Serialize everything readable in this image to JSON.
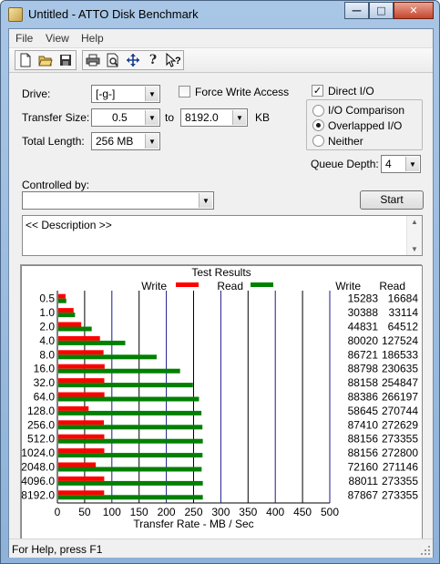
{
  "window": {
    "title": "Untitled - ATTO Disk Benchmark",
    "min": "—",
    "max": "□",
    "close": "✕"
  },
  "menu": [
    "File",
    "View",
    "Help"
  ],
  "toolbar": {
    "icons": [
      "new-icon",
      "open-icon",
      "save-icon",
      "print-icon",
      "print-preview-icon",
      "move-icon",
      "help-icon",
      "context-help-icon"
    ]
  },
  "form": {
    "drive_label": "Drive:",
    "drive_value": "[-g-]",
    "force_write_label": "Force Write Access",
    "force_write_checked": false,
    "transfer_label": "Transfer Size:",
    "transfer_from": "0.5",
    "transfer_to_word": "to",
    "transfer_to": "8192.0",
    "transfer_unit": "KB",
    "length_label": "Total Length:",
    "length_value": "256 MB",
    "direct_io_label": "Direct I/O",
    "direct_io_checked": true,
    "radio_io_comparison": "I/O Comparison",
    "radio_overlapped": "Overlapped I/O",
    "radio_neither": "Neither",
    "radio_selected": "overlapped",
    "queue_label": "Queue Depth:",
    "queue_value": "4",
    "controlled_label": "Controlled by:",
    "controlled_value": "",
    "start_label": "Start",
    "description": "<< Description >>"
  },
  "results": {
    "title": "Test Results",
    "legend_write": "Write",
    "legend_read": "Read",
    "col_write": "Write",
    "col_read": "Read",
    "xlabel": "Transfer Rate - MB / Sec",
    "write_color": "#ff0000",
    "read_color": "#008000"
  },
  "chart_data": {
    "type": "bar",
    "title": "Test Results",
    "xlabel": "Transfer Rate - MB / Sec",
    "xlim": [
      0,
      500
    ],
    "xticks": [
      0,
      50,
      100,
      150,
      200,
      250,
      300,
      350,
      400,
      450,
      500
    ],
    "categories": [
      "0.5",
      "1.0",
      "2.0",
      "4.0",
      "8.0",
      "16.0",
      "32.0",
      "64.0",
      "128.0",
      "256.0",
      "512.0",
      "1024.0",
      "2048.0",
      "4096.0",
      "8192.0"
    ],
    "series": [
      {
        "name": "Write",
        "values": [
          15283,
          30388,
          44831,
          80020,
          86721,
          88798,
          88158,
          88386,
          58645,
          87410,
          88156,
          88156,
          72160,
          88011,
          87867
        ]
      },
      {
        "name": "Read",
        "values": [
          16684,
          33114,
          64512,
          127524,
          186533,
          230635,
          254847,
          266197,
          270744,
          272629,
          273355,
          272800,
          271146,
          273355,
          273355
        ]
      }
    ]
  },
  "status": "For Help, press F1"
}
